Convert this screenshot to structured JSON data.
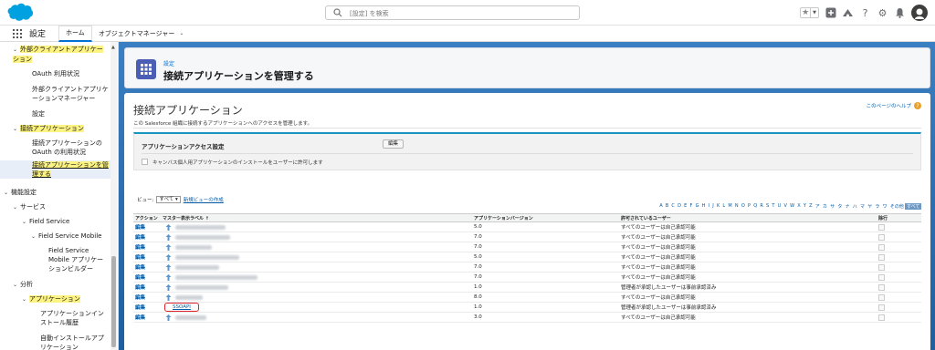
{
  "topbar": {
    "search_placeholder": "[設定] を検索"
  },
  "navbar": {
    "app_name": "設定",
    "tabs": [
      {
        "label": "ホーム"
      },
      {
        "label": "オブジェクトマネージャー"
      }
    ]
  },
  "sidebar": {
    "items": [
      {
        "label": "外部クライアントアプリケーション"
      },
      {
        "label": "OAuth 利用状況"
      },
      {
        "label": "外部クライアントアプリケーションマネージャー"
      },
      {
        "label": "設定"
      },
      {
        "label": "接続アプリケーション"
      },
      {
        "label": "接続アプリケーションの OAuth の利用状況"
      },
      {
        "label": "接続アプリケーションを管理する"
      },
      {
        "label": "機能設定"
      },
      {
        "label": "サービス"
      },
      {
        "label": "Field Service"
      },
      {
        "label": "Field Service Mobile"
      },
      {
        "label": "Field Service Mobile アプリケーションビルダー"
      },
      {
        "label": "分析"
      },
      {
        "label": "アプリケーション"
      },
      {
        "label": "アプリケーションインストール履歴"
      },
      {
        "label": "自動インストールアプリケーション"
      }
    ]
  },
  "header": {
    "breadcrumb": "設定",
    "title": "接続アプリケーションを管理する"
  },
  "content": {
    "title": "接続アプリケーション",
    "help_link": "このページのヘルプ",
    "description": "この Salesforce 組織に接続するアプリケーションへのアクセスを管理します。",
    "access": {
      "title": "アプリケーションアクセス設定",
      "edit_button": "編集",
      "checkbox_label": "キャンバス個人用アプリケーションのインストールをユーザーに許可します"
    },
    "view": {
      "label": "ビュー:",
      "selected": "すべて",
      "new_view_link": "新規ビューの作成"
    },
    "alpha_filter": [
      "A",
      "B",
      "C",
      "D",
      "E",
      "F",
      "G",
      "H",
      "I",
      "J",
      "K",
      "L",
      "M",
      "N",
      "O",
      "P",
      "Q",
      "R",
      "S",
      "T",
      "U",
      "V",
      "W",
      "X",
      "Y",
      "Z",
      "ア",
      "カ",
      "サ",
      "タ",
      "ナ",
      "ハ",
      "マ",
      "ヤ",
      "ラ",
      "ワ",
      "その他",
      "すべて"
    ],
    "table": {
      "headers": [
        "アクション",
        "マスター表示ラベル ↑",
        "アプリケーションバージョン",
        "許可されているユーザー",
        "除行"
      ],
      "edit_label": "編集",
      "rows": [
        {
          "version": "5.0",
          "users": "すべてのユーザーは自己承認可能",
          "label": ""
        },
        {
          "version": "7.0",
          "users": "すべてのユーザーは自己承認可能",
          "label": ""
        },
        {
          "version": "7.0",
          "users": "すべてのユーザーは自己承認可能",
          "label": ""
        },
        {
          "version": "5.0",
          "users": "すべてのユーザーは自己承認可能",
          "label": ""
        },
        {
          "version": "7.0",
          "users": "すべてのユーザーは自己承認可能",
          "label": ""
        },
        {
          "version": "7.0",
          "users": "すべてのユーザーは自己承認可能",
          "label": ""
        },
        {
          "version": "1.0",
          "users": "管理者が承認したユーザーは事前承認済み",
          "label": ""
        },
        {
          "version": "8.0",
          "users": "すべてのユーザーは自己承認可能",
          "label": ""
        },
        {
          "version": "1.0",
          "users": "管理者が承認したユーザーは事前承認済み",
          "label": "SSOAPI"
        },
        {
          "version": "3.0",
          "users": "すべてのユーザーは自己承認可能",
          "label": ""
        }
      ]
    }
  }
}
